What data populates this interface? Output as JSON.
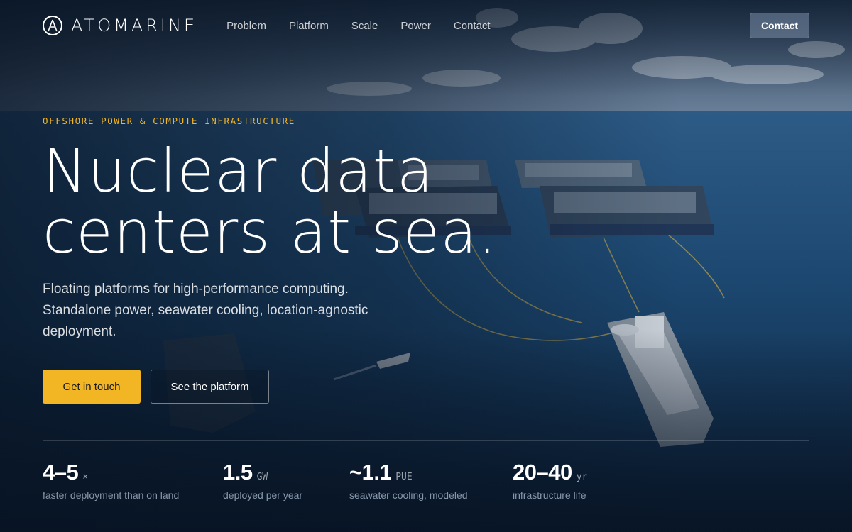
{
  "brand": {
    "name": "ATOMARINE"
  },
  "nav": {
    "links": [
      "Problem",
      "Platform",
      "Scale",
      "Power",
      "Contact"
    ],
    "cta": "Contact"
  },
  "hero": {
    "eyebrow": "OFFSHORE POWER & COMPUTE INFRASTRUCTURE",
    "headline_line1": "Nuclear data",
    "headline_line2": "centers at sea.",
    "subcopy": "Floating platforms for high-performance computing. Standalone power, seawater cooling, location-agnostic deployment.",
    "primary_cta": "Get in touch",
    "secondary_cta": "See the platform"
  },
  "stats": [
    {
      "value": "4–5",
      "unit": "×",
      "label": "faster deployment than on land"
    },
    {
      "value": "1.5",
      "unit": "GW",
      "label": "deployed per year"
    },
    {
      "value": "~1.1",
      "unit": "PUE",
      "label": "seawater cooling, modeled"
    },
    {
      "value": "20–40",
      "unit": "yr",
      "label": "infrastructure life"
    }
  ],
  "colors": {
    "accent": "#f2b524",
    "background": "#0b1a2c",
    "ocean": "#1d4a74",
    "sky": "#3d5a78"
  },
  "icons": {
    "brand_mark": "atom-a-logo-icon"
  }
}
